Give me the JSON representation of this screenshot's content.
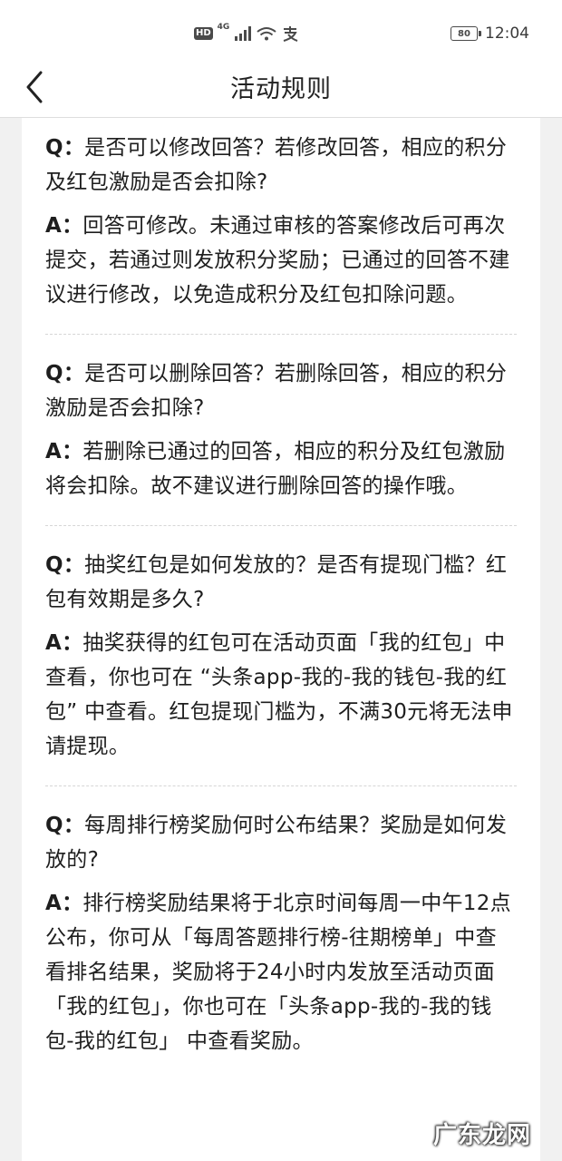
{
  "status_bar": {
    "hd": "HD",
    "network": "4G",
    "time": "12:04",
    "battery_level": "80"
  },
  "nav": {
    "title": "活动规则"
  },
  "faq": [
    {
      "q_prefix": "Q：",
      "q": "是否可以修改回答？若修改回答，相应的积分及红包激励是否会扣除?",
      "a_prefix": "A：",
      "a": "回答可修改。未通过审核的答案修改后可再次提交，若通过则发放积分奖励；已通过的回答不建议进行修改，以免造成积分及红包扣除问题。"
    },
    {
      "q_prefix": "Q：",
      "q": "是否可以删除回答？若删除回答，相应的积分激励是否会扣除?",
      "a_prefix": "A：",
      "a": "若删除已通过的回答，相应的积分及红包激励将会扣除。故不建议进行删除回答的操作哦。"
    },
    {
      "q_prefix": "Q：",
      "q": "抽奖红包是如何发放的？是否有提现门槛？红包有效期是多久?",
      "a_prefix": "A：",
      "a": "抽奖获得的红包可在活动页面「我的红包」中查看，你也可在 “头条app-我的-我的钱包-我的红包” 中查看。红包提现门槛为，不满30元将无法申请提现。"
    },
    {
      "q_prefix": "Q：",
      "q": "每周排行榜奖励何时公布结果？奖励是如何发放的?",
      "a_prefix": "A：",
      "a": "排行榜奖励结果将于北京时间每周一中午12点公布，你可从「每周答题排行榜-往期榜单」中查看排名结果，奖励将于24小时内发放至活动页面「我的红包」，你也可在「头条app-我的-我的钱包-我的红包」 中查看奖励。"
    }
  ],
  "watermark": "广东龙网"
}
